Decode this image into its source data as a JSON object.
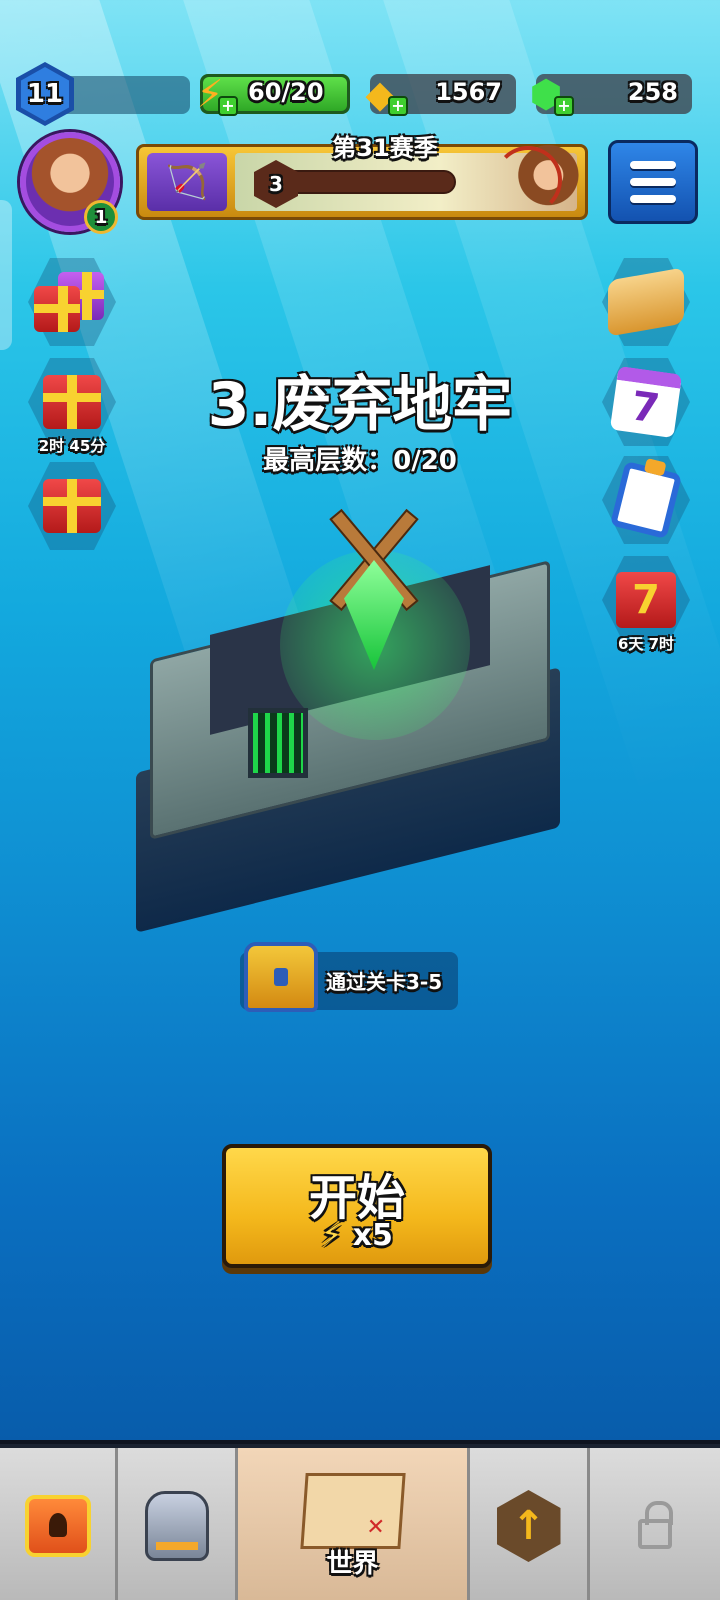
{
  "hud": {
    "player_level": "11",
    "energy": "60/20",
    "gold": "1567",
    "gems": "258",
    "avatar_badge": "1"
  },
  "season": {
    "title": "第31赛季",
    "tier": "3"
  },
  "side_left": [
    {
      "name": "gift-bundle",
      "label": ""
    },
    {
      "name": "timed-pack",
      "label": "2时 45分"
    },
    {
      "name": "free-gift",
      "label": ""
    }
  ],
  "side_right": [
    {
      "name": "land-event",
      "label": ""
    },
    {
      "name": "calendar-7",
      "label": ""
    },
    {
      "name": "quests",
      "label": ""
    },
    {
      "name": "gift-7",
      "label": "6天 7时"
    }
  ],
  "stage": {
    "title": "3.废弃地牢",
    "best_floor": "最高层数：0/20"
  },
  "reward": {
    "text": "通过关卡3-5"
  },
  "start": {
    "label": "开始",
    "cost": "x5"
  },
  "nav": {
    "world_label": "世界",
    "tabs": [
      "shop",
      "equipment",
      "world",
      "upgrade",
      "locked"
    ]
  },
  "colors": {
    "accent_gold": "#f4b81c",
    "energy_green": "#3fcf2f",
    "menu_blue": "#1352b0"
  }
}
